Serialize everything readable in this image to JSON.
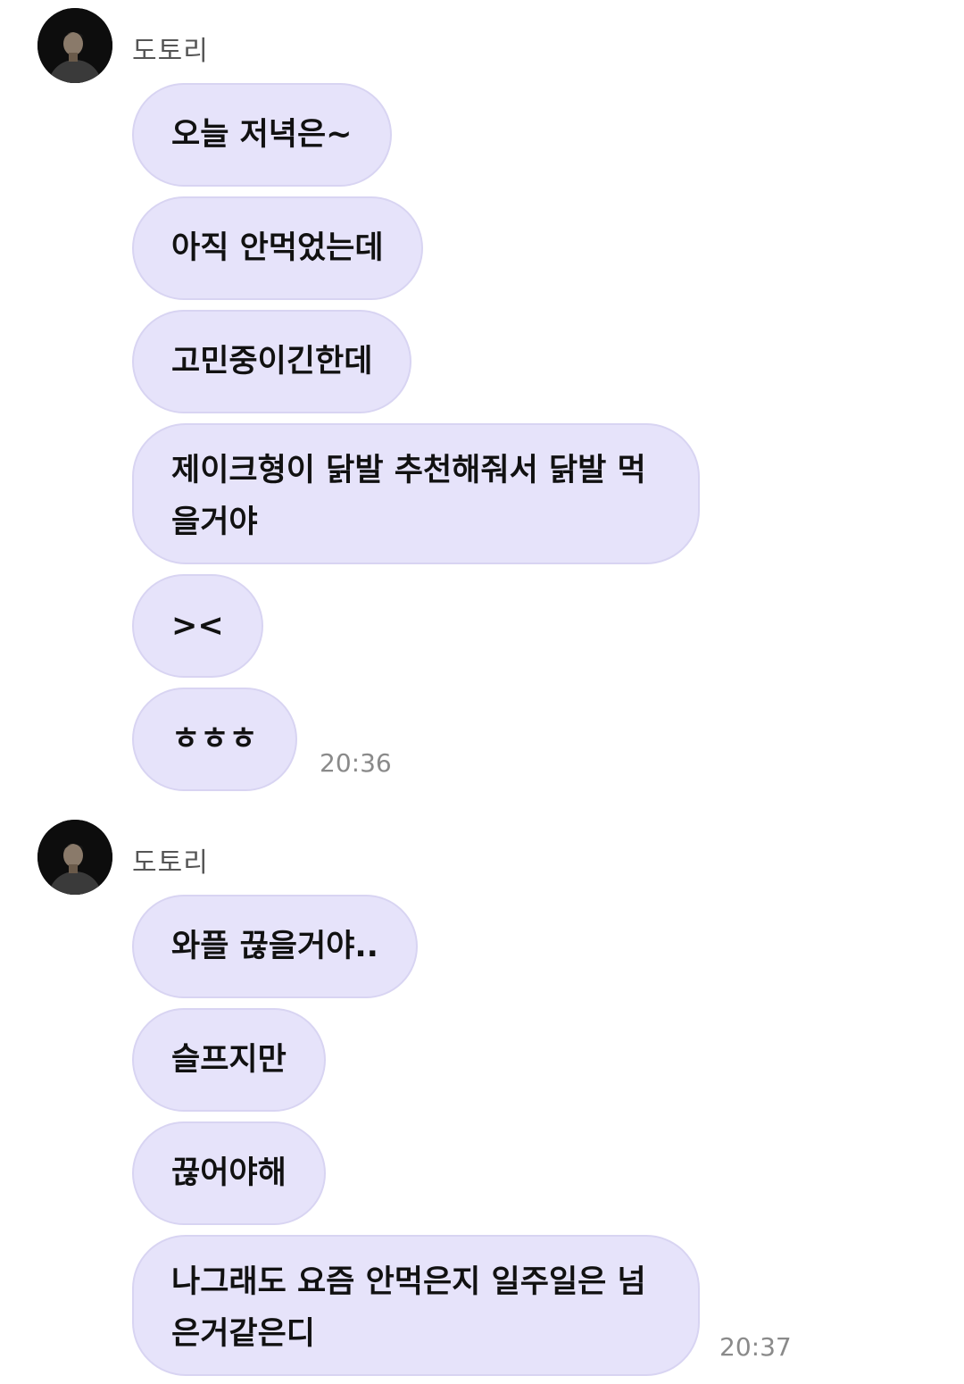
{
  "groups": [
    {
      "sender": "도토리",
      "time": "20:36",
      "messages": [
        "오늘 저녁은~",
        "아직 안먹었는데",
        "고민중이긴한데",
        "제이크형이 닭발 추천해줘서 닭발 먹을거야",
        "><",
        "ㅎㅎㅎ"
      ]
    },
    {
      "sender": "도토리",
      "time": "20:37",
      "messages": [
        "와플 끊을거야..",
        "슬프지만",
        "끊어야해",
        "나그래도 요즘 안먹은지 일주일은 넘은거같은디"
      ]
    }
  ],
  "colors": {
    "bubble_bg": "#e6e3fa",
    "bubble_border": "#d8d4f2",
    "sender_text": "#555555",
    "time_text": "#8a8a8a"
  },
  "icons": {
    "avatar": "profile-photo"
  }
}
